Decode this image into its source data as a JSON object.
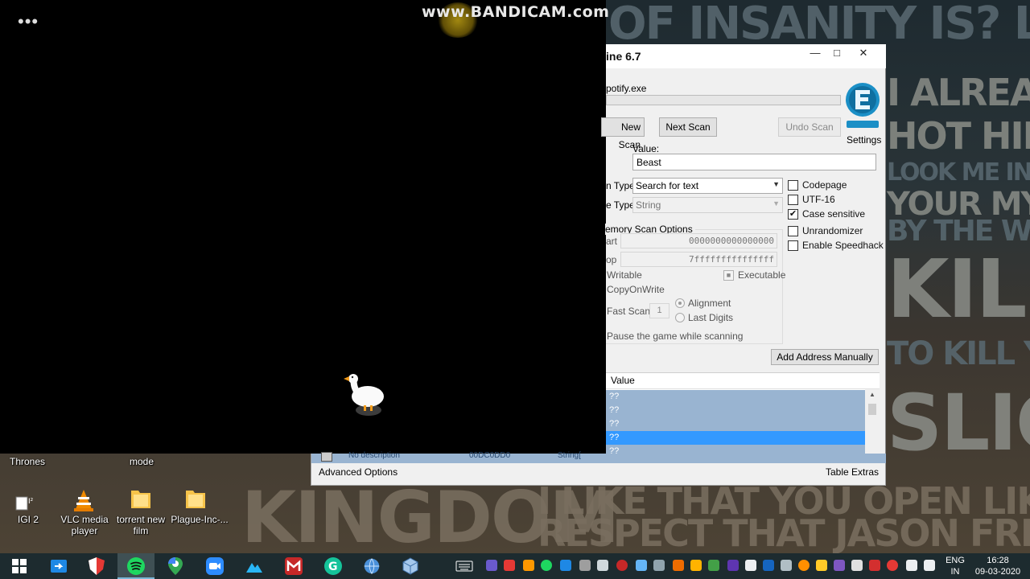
{
  "watermark": "www.BANDICAM.com",
  "overlay": {
    "menu_dots": "•••"
  },
  "cheat_engine": {
    "title": "ine 6.7",
    "process": "potify.exe",
    "buttons": {
      "new_scan": "New Scan",
      "next_scan": "Next Scan",
      "undo_scan": "Undo Scan",
      "add_address": "Add Address Manually"
    },
    "settings_label": "Settings",
    "value_label": "Value:",
    "value_input": "Beast",
    "scan_type_label": "n Type",
    "scan_type_value": "Search for text",
    "value_type_label": "e Type",
    "value_type_value": "String",
    "memory_group_title": "emory Scan Options",
    "start_label": "art",
    "start_value": "0000000000000000",
    "stop_label": "op",
    "stop_value": "7fffffffffffffff",
    "writable": "Writable",
    "executable": "Executable",
    "copy_on_write": "CopyOnWrite",
    "fast_scan": "Fast Scan",
    "fast_scan_value": "1",
    "alignment": "Alignment",
    "last_digits": "Last Digits",
    "pause_game": "Pause the game while scanning",
    "checkboxes": {
      "codepage": "Codepage",
      "utf16": "UTF-16",
      "case_sensitive": "Case sensitive",
      "unrandomizer": "Unrandomizer",
      "speedhack": "Enable Speedhack"
    },
    "checks": {
      "case_sensitive": "✔",
      "executable": "■"
    },
    "results_header": "Value",
    "results": [
      "??",
      "??",
      "??",
      "??",
      "??"
    ],
    "selected_row": 3
  },
  "address_table": {
    "advanced_options": "Advanced Options",
    "table_extras": "Table Extras",
    "ghost_desc": "No description",
    "ghost_addr": "00DC0DD0",
    "ghost_type": "String["
  },
  "desktop_icons": {
    "thrones": "Thrones",
    "mode": "mode",
    "igi2": "IGI 2",
    "vlc_line1": "VLC media",
    "vlc_line2": "player",
    "torrent_line1": "torrent new",
    "torrent_line2": "film",
    "plague": "Plague-Inc-..."
  },
  "taskbar": {
    "language_line1": "ENG",
    "language_line2": "IN",
    "time": "16:28",
    "date": "09-03-2020"
  },
  "colors": {
    "selection_blue": "#3399ff",
    "row_blue": "#99b4d1",
    "taskbar": "#1d2b2f"
  }
}
